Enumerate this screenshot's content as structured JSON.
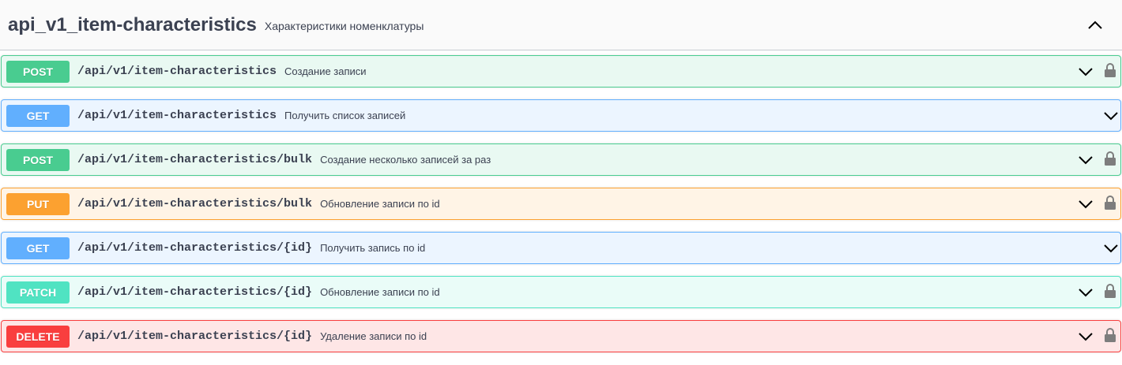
{
  "tag": {
    "name": "api_v1_item-characteristics",
    "description": "Характеристики номенклатуры",
    "collapse_icon": "chevron-up-icon"
  },
  "colors": {
    "post": "#49cc90",
    "get": "#61affe",
    "put": "#fca130",
    "patch": "#50e3c2",
    "delete": "#f93e3e"
  },
  "operations": [
    {
      "method": "POST",
      "path": "/api/v1/item-characteristics",
      "summary": "Создание записи",
      "locked": true
    },
    {
      "method": "GET",
      "path": "/api/v1/item-characteristics",
      "summary": "Получить список записей",
      "locked": false
    },
    {
      "method": "POST",
      "path": "/api/v1/item-characteristics/bulk",
      "summary": "Создание несколько записей за раз",
      "locked": true
    },
    {
      "method": "PUT",
      "path": "/api/v1/item-characteristics/bulk",
      "summary": "Обновление записи по id",
      "locked": true
    },
    {
      "method": "GET",
      "path": "/api/v1/item-characteristics/{id}",
      "summary": "Получить запись по id",
      "locked": false
    },
    {
      "method": "PATCH",
      "path": "/api/v1/item-characteristics/{id}",
      "summary": "Обновление записи по id",
      "locked": true
    },
    {
      "method": "DELETE",
      "path": "/api/v1/item-characteristics/{id}",
      "summary": "Удаление записи по id",
      "locked": true
    }
  ]
}
